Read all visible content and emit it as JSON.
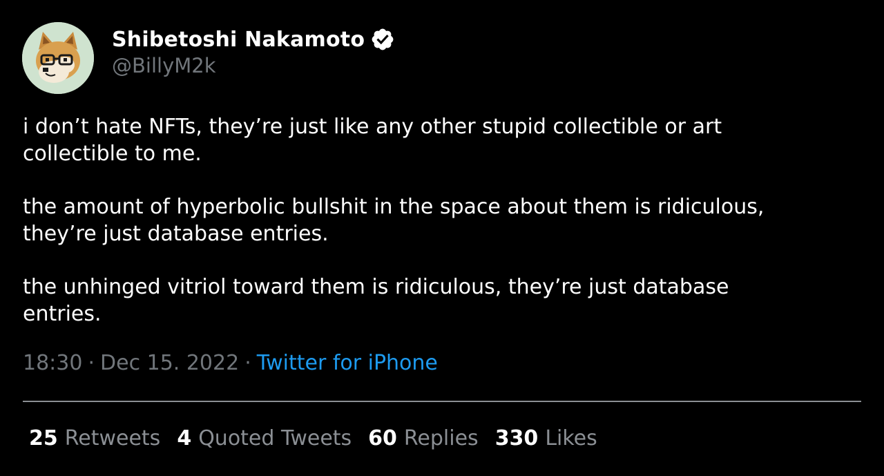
{
  "author": {
    "display_name": "Shibetoshi Nakamoto",
    "handle": "@BillyM2k",
    "verified_icon": "verified-badge-icon",
    "avatar": "shiba-inu-with-glasses"
  },
  "tweet": {
    "paragraphs": [
      "i don’t hate NFTs, they’re just like any other stupid collectible or art\ncollectible to me.",
      "the amount of hyperbolic bullshit in the space about them is ridiculous,\nthey’re just database entries.",
      "the unhinged vitriol toward them is ridiculous, they’re just database\nentries."
    ],
    "time": "18:30",
    "separator": "·",
    "date": "Dec 15. 2022",
    "source": "Twitter for iPhone"
  },
  "stats": [
    {
      "count": "25",
      "label": "Retweets"
    },
    {
      "count": "4",
      "label": "Quoted Tweets"
    },
    {
      "count": "60",
      "label": "Replies"
    },
    {
      "count": "330",
      "label": "Likes"
    }
  ],
  "colors": {
    "background": "#000000",
    "text": "#ffffff",
    "muted": "#71767b",
    "link": "#1d9bf0",
    "divider": "#8b8f94"
  }
}
